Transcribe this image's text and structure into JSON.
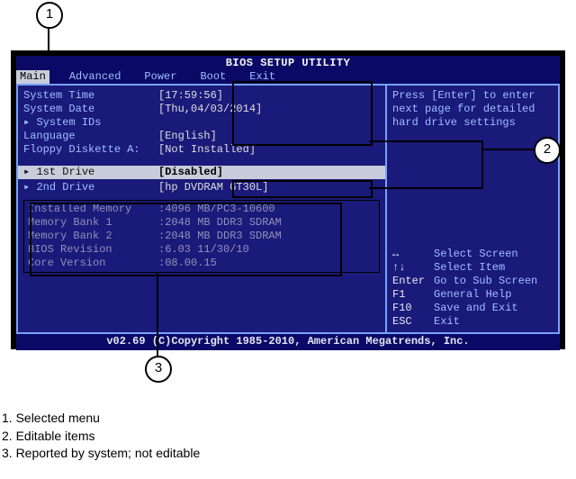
{
  "bios": {
    "title": "BIOS SETUP UTILITY",
    "tabs": [
      "Main",
      "Advanced",
      "Power",
      "Boot",
      "Exit"
    ],
    "active_tab": "Main",
    "left": {
      "system_time_label": "System Time",
      "system_time_value": "[17:59:56]",
      "system_date_label": "System Date",
      "system_date_value": "[Thu,04/03/2014]",
      "system_ids_label": "System IDs",
      "language_label": "Language",
      "language_value": "[English]",
      "floppy_label": "Floppy Diskette A:",
      "floppy_value": "[Not Installed]",
      "drive1_label": "1st Drive",
      "drive1_value": "[Disabled]",
      "drive2_label": "2nd Drive",
      "drive2_value": "[hp DVDRAM GT30L]"
    },
    "info": {
      "mem_label": "Installed Memory",
      "mem_value": ":4096 MB/PC3-10600",
      "bank1_label": "Memory Bank 1",
      "bank1_value": ":2048 MB DDR3 SDRAM",
      "bank2_label": "Memory Bank 2",
      "bank2_value": ":2048 MB DDR3 SDRAM",
      "biosrev_label": "BIOS Revision",
      "biosrev_value": ":6.03 11/30/10",
      "core_label": "Core Version",
      "core_value": ":08.00.15"
    },
    "help": "Press [Enter] to enter next page for detailed hard drive settings",
    "nav": {
      "k1": "↔",
      "v1": "Select Screen",
      "k2": "↑↓",
      "v2": "Select Item",
      "k3": "Enter",
      "v3": "Go to Sub Screen",
      "k4": "F1",
      "v4": "General Help",
      "k5": "F10",
      "v5": "Save and Exit",
      "k6": "ESC",
      "v6": "Exit"
    },
    "footer": "v02.69 (C)Copyright 1985-2010, American Megatrends, Inc."
  },
  "callouts": {
    "c1": "1",
    "c2": "2",
    "c3": "3"
  },
  "legend": {
    "l1": "1. Selected menu",
    "l2": "2. Editable items",
    "l3": "3. Reported by system; not editable"
  }
}
